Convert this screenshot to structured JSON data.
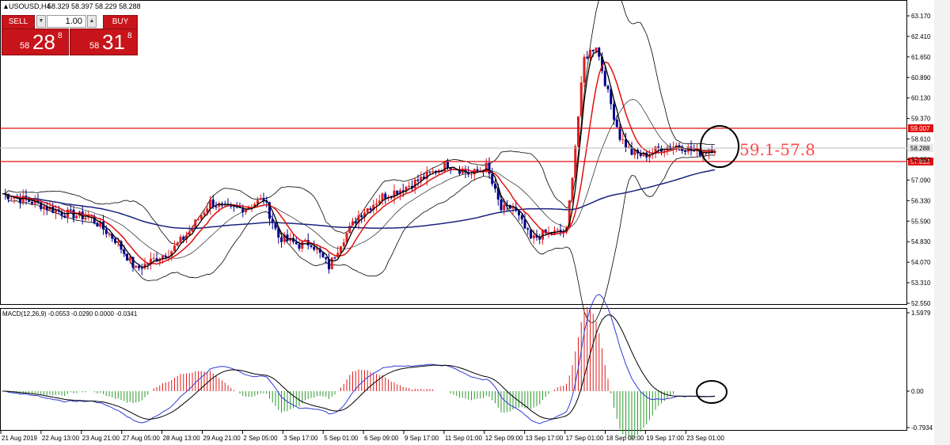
{
  "header": {
    "title": "USOUSD,H4",
    "ohlc": "58.329 58.397 58.229 58.288"
  },
  "trade_panel": {
    "sell_label": "SELL",
    "buy_label": "BUY",
    "lot_value": "1.00",
    "sell_price": {
      "prefix": "58",
      "big": "28",
      "sup": "8"
    },
    "buy_price": {
      "prefix": "58",
      "big": "31",
      "sup": "8"
    }
  },
  "price_axis": {
    "ticks": [
      "63.170",
      "62.410",
      "61.650",
      "60.890",
      "60.130",
      "59.370",
      "58.610",
      "57.850",
      "57.090",
      "56.330",
      "55.590",
      "54.830",
      "54.070",
      "53.310",
      "52.550"
    ],
    "resistance_label": "59.007",
    "current_label": "58.288",
    "support_label": "57.813"
  },
  "annotation": {
    "range_text": "59.1-57.8"
  },
  "macd": {
    "label": "MACD(12,26,9) -0.0553 -0.0290 0.0000 -0.0341",
    "ticks": [
      "1.5979",
      "0.00",
      "-0.7934"
    ]
  },
  "time_axis": {
    "ticks": [
      "21 Aug 2019",
      "22 Aug 13:00",
      "23 Aug 21:00",
      "27 Aug 05:00",
      "28 Aug 13:00",
      "29 Aug 21:00",
      "2 Sep 05:00",
      "3 Sep 17:00",
      "5 Sep 01:00",
      "6 Sep 09:00",
      "9 Sep 17:00",
      "11 Sep 01:00",
      "12 Sep 09:00",
      "13 Sep 17:00",
      "17 Sep 01:00",
      "18 Sep 09:00",
      "19 Sep 17:00",
      "23 Sep 01:00"
    ]
  },
  "colors": {
    "bull": "#e01e1e",
    "bear": "#00008b",
    "level": "#e01010",
    "ma_fast": "#000000",
    "ma_mid": "#e01010",
    "ma_slow": "#1a237e",
    "macd_line": "#2f3cd8",
    "signal_line": "#000000",
    "hist_pos": "#e01e1e",
    "hist_neg": "#2e9a2e"
  }
}
